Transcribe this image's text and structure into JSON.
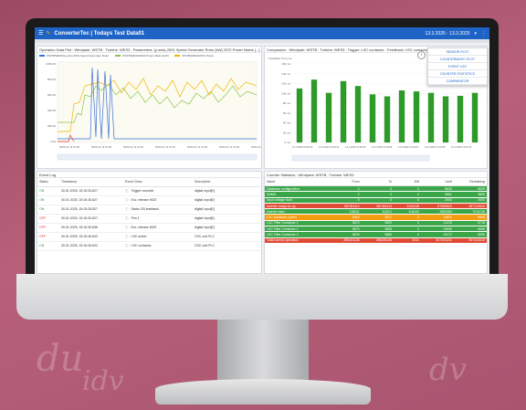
{
  "app": {
    "title": "ConverterTec | Todays Test Data01",
    "date_range": "13.3.2025 - 13.3.2025"
  },
  "colors": {
    "appbar": "#1e63c6",
    "bar_green": "#2e9a2a",
    "row_green": "#3aa649",
    "row_red": "#e04b35",
    "row_orange": "#f39c12"
  },
  "operation_plot": {
    "title": "Operation Data Plot : Windpark: WSTB : Turbine: WES3 : Parameters: (y-axis) 2001 Speed Generator Rotor [kW] 2072 Power Mains [...]",
    "legend": [
      {
        "label": "WSTB/WES3/(y-axis) 2001 Speed Generator Rotor",
        "color": "#3b6fd9"
      },
      {
        "label": "WSTB/WES3/2002 Power Mains [kW]",
        "color": "#8bc34a"
      },
      {
        "label": "WSTB/WES3/2072 Power",
        "color": "#f5b400"
      }
    ],
    "y_ticks": [
      "1000.00",
      "800.00",
      "600.00",
      "400.00",
      "200.00",
      "0.00"
    ],
    "x_ticks": [
      "2025-01-13 10:00",
      "2025-01-13 10:30",
      "2025-01-13 11:00",
      "2025-01-13 11:30",
      "2025-01-13 12:00",
      "2025-01-13 12:30",
      "2025-01-13 13:00"
    ]
  },
  "comparator": {
    "title": "Comparator : Windpark: WSTB : Turbine: WES3 : Trigger: LSC contactor : Feedback: LSC contactor fe...",
    "ylabel": "Feedback Time ms",
    "y_ticks": [
      "160 ms",
      "140 ms",
      "120 ms",
      "100 ms",
      "80 ms",
      "60 ms",
      "40 ms",
      "20 ms",
      "0 ms"
    ],
    "bars": [
      110,
      128,
      101,
      125,
      115,
      98,
      94,
      106,
      104,
      101,
      94,
      95,
      101
    ],
    "x_labels": [
      "13.1.2025 10:00:15",
      "13.1.2025 10:25:31",
      "13.1.2025 10:48:44",
      "13.1.2025 11:18:09",
      "13.1.2025 11:43:22",
      "13.1.2025 12:10:55",
      "13.1.2025 12:41:37"
    ]
  },
  "menu": [
    "SENSOR PLOT",
    "COUNTERMATIC PLOT",
    "EVENT LOG",
    "COUNTER STATISTICS",
    "COMPARATOR"
  ],
  "event_log": {
    "title": "Event Log",
    "columns": [
      "Status",
      "Timestamp",
      "Event Class",
      "Description"
    ],
    "rows": [
      {
        "status": "ON",
        "ts": "30.01.2025, 15:15:26.827",
        "cls": "Trigger recorder",
        "desc": "digital input[0]"
      },
      {
        "status": "ON",
        "ts": "30.01.2025, 15:15:26.827",
        "cls": "Exc. release MCE",
        "desc": "digital input[0]"
      },
      {
        "status": "ON",
        "ts": "30.01.2025, 15:15:26.827",
        "cls": "Stator CB feedback",
        "desc": "digital input[0]"
      },
      {
        "status": "OFF",
        "ts": "30.01.2025, 15:15:26.827",
        "cls": "Pen 1",
        "desc": "digital input[0]"
      },
      {
        "status": "OFF",
        "ts": "30.01.2025, 15:15:26.836",
        "cls": "Exc. release MCE",
        "desc": "digital input[0]"
      },
      {
        "status": "OFF",
        "ts": "30.01.2025, 15:15:26.842",
        "cls": "LSC active",
        "desc": "CSC-unit PLC"
      },
      {
        "status": "ON",
        "ts": "30.01.2025, 15:15:26.842",
        "cls": "LSC contactor",
        "desc": "CSC-unit PLC"
      }
    ]
  },
  "counter_stats": {
    "title": "Counter Statistics : Windpark: WSTB : Turbine: WES3",
    "columns": [
      "Name",
      "From",
      "To",
      "Diff",
      "Limit",
      "Remaining"
    ],
    "rows": [
      {
        "color": "#3aa649",
        "name": "Database configuration",
        "from": "0",
        "to": "0",
        "diff": "0",
        "limit": "8625",
        "rem": "8625"
      },
      {
        "color": "#3aa649",
        "name": "DHMS",
        "from": "2",
        "to": "2",
        "diff": "0",
        "limit": "3861",
        "rem": "3859"
      },
      {
        "color": "#3aa649",
        "name": "Input voltage fault",
        "from": "0",
        "to": "0",
        "diff": "0",
        "limit": "2000",
        "rem": "2000"
      },
      {
        "color": "#e04b35",
        "name": "Inverter ready for op.",
        "from": "387351114",
        "to": "387351124",
        "diff": "1234148",
        "limit": "67080523",
        "rem": "357123522"
      },
      {
        "color": "#3aa649",
        "name": "Inverter start",
        "from": "118011",
        "to": "118211",
        "diff": "118100",
        "limit": "1583360",
        "rem": "7016746"
      },
      {
        "color": "#f39c12",
        "name": "LSC contactor cycles",
        "from": "5916",
        "to": "5917",
        "diff": "2",
        "limit": "11811",
        "rem": "5895"
      },
      {
        "color": "#3aa649",
        "name": "LSC Filter Contactor 1",
        "from": "5672",
        "to": "5692",
        "diff": "0",
        "limit": "11210",
        "rem": "5718"
      },
      {
        "color": "#3aa649",
        "name": "LSC Filter Contactor 2",
        "from": "5675",
        "to": "5683",
        "diff": "0",
        "limit": "13050",
        "rem": "5636"
      },
      {
        "color": "#3aa649",
        "name": "LSC Filter Contactor 3",
        "from": "5876",
        "to": "5880",
        "diff": "0",
        "limit": "13172",
        "rem": "5699"
      },
      {
        "color": "#e04b35",
        "name": "Total normal operation",
        "from": "286431128",
        "to": "286451140",
        "diff": "2011",
        "limit": "307331221",
        "rem": "507101619"
      }
    ]
  }
}
